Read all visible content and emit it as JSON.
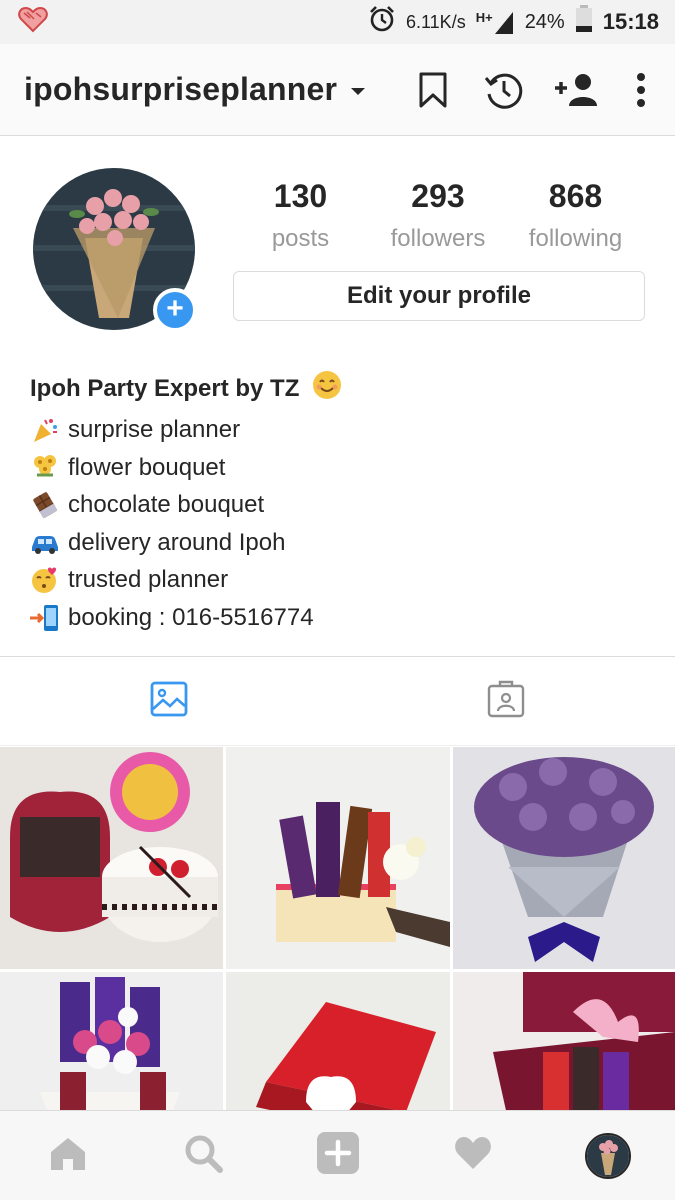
{
  "status_bar": {
    "net_speed": "6.11K/s",
    "network": "H+",
    "battery": "24%",
    "time": "15:18"
  },
  "header": {
    "username": "ipohsurpriseplanner",
    "icons": [
      "bookmark-icon",
      "history-icon",
      "add-person-icon",
      "more-icon"
    ]
  },
  "profile": {
    "posts_count": "130",
    "posts_label": "posts",
    "followers_count": "293",
    "followers_label": "followers",
    "following_count": "868",
    "following_label": "following",
    "edit_button": "Edit your profile"
  },
  "bio": {
    "name": "Ipoh Party Expert by TZ",
    "lines": [
      {
        "emoji": "party-popper",
        "text": "surprise planner"
      },
      {
        "emoji": "bouquet",
        "text": "flower bouquet"
      },
      {
        "emoji": "chocolate-bar",
        "text": "chocolate bouquet"
      },
      {
        "emoji": "car",
        "text": "delivery around Ipoh"
      },
      {
        "emoji": "kissing-face",
        "text": "trusted planner"
      },
      {
        "emoji": "phone-arrow",
        "text": "booking : 016-5516774"
      }
    ]
  },
  "tabs": [
    {
      "name": "grid-posts",
      "active": true
    },
    {
      "name": "tagged-posts",
      "active": false
    }
  ],
  "colors": {
    "accent": "#3897f0",
    "muted_text": "#999999",
    "border": "#dbdbdb"
  },
  "bottom_nav": [
    "home-icon",
    "search-icon",
    "add-post-icon",
    "activity-heart-icon",
    "profile-avatar"
  ]
}
